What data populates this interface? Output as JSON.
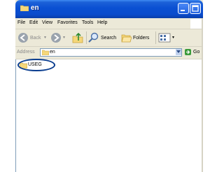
{
  "window": {
    "title": "en"
  },
  "menu": {
    "items": [
      "File",
      "Edit",
      "View",
      "Favorites",
      "Tools",
      "Help"
    ]
  },
  "toolbar": {
    "back_label": "Back",
    "search_label": "Search",
    "folders_label": "Folders"
  },
  "address": {
    "label": "Address",
    "value": "en",
    "go_label": "Go"
  },
  "content": {
    "items": [
      {
        "name": "USEG",
        "icon": "folder-icon"
      }
    ]
  },
  "colors": {
    "titlebar": "#0a50d2",
    "chrome": "#ece9d8",
    "highlight_ring": "#0a3d8f"
  }
}
